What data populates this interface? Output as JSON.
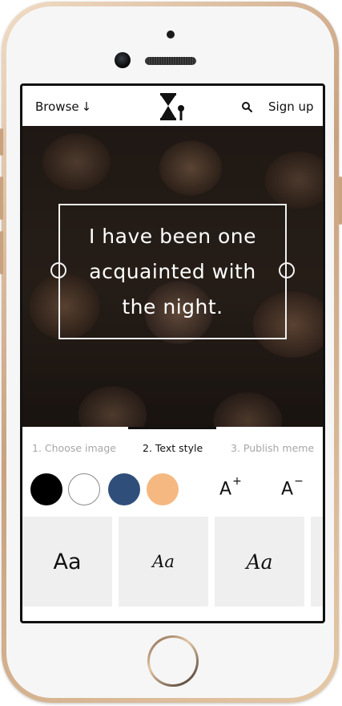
{
  "header": {
    "browse_label": "Browse",
    "browse_arrow": "↓",
    "signup_label": "Sign up",
    "search_icon": "search-icon",
    "logo_icon": "hourglass-logo"
  },
  "meme": {
    "text": "I have been one acquainted with the night."
  },
  "steps": [
    {
      "label": "1. Choose image",
      "active": false
    },
    {
      "label": "2. Text style",
      "active": true
    },
    {
      "label": "3. Publish meme",
      "active": false
    }
  ],
  "colors": [
    "#000000",
    "#ffffff",
    "#2f4f7a",
    "#f5b880"
  ],
  "size_controls": {
    "increase": {
      "glyph": "A",
      "sign": "+"
    },
    "decrease": {
      "glyph": "A",
      "sign": "−"
    }
  },
  "fonts": [
    {
      "sample": "Aa"
    },
    {
      "sample": "Aa"
    },
    {
      "sample": "Aa"
    }
  ]
}
